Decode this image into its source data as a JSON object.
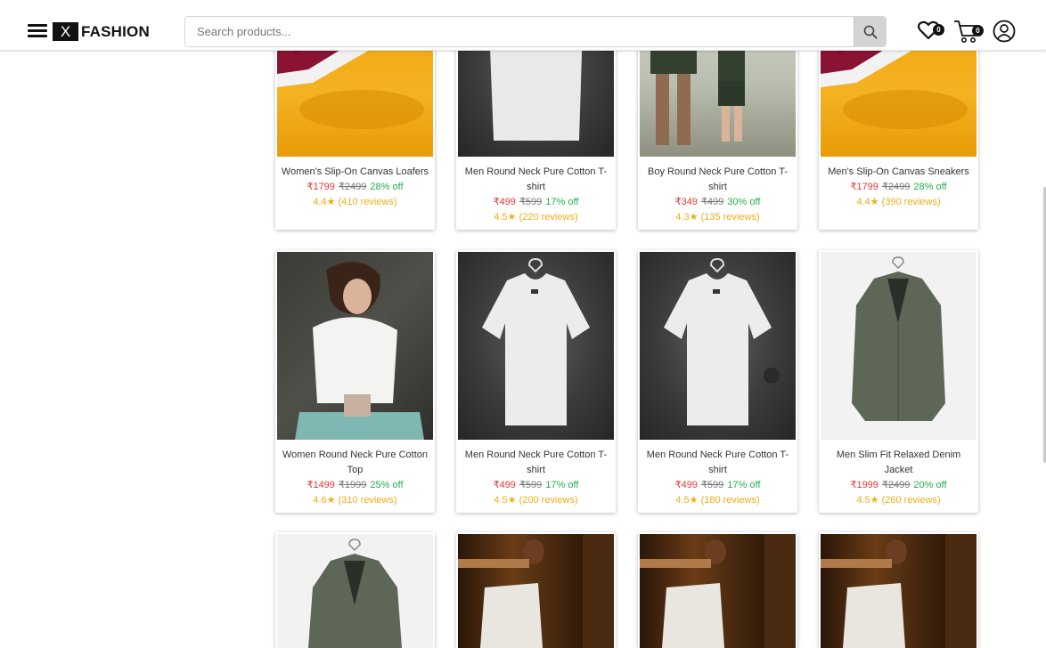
{
  "brand": {
    "logo_mark": "X",
    "name": "FASHION"
  },
  "header": {
    "search_placeholder": "Search products...",
    "wishlist_count": "0",
    "cart_count": "0",
    "icons": [
      "menu-icon",
      "search-icon",
      "heart-icon",
      "cart-icon",
      "user-icon"
    ]
  },
  "colors": {
    "price": "#e53935",
    "discount": "#22b14c",
    "rating": "#f0ad17",
    "brand_black": "#111111"
  },
  "products": [
    {
      "name": "Women's Slip-On Canvas Loafers",
      "price": "₹1799",
      "mrp": "₹2499",
      "off": "28% off",
      "rating": "4.4★ (410 reviews)"
    },
    {
      "name": "Men Round Neck Pure Cotton T-shirt",
      "price": "₹499",
      "mrp": "₹599",
      "off": "17% off",
      "rating": "4.5★ (220 reviews)"
    },
    {
      "name": "Boy Round Neck Pure Cotton T-shirt",
      "price": "₹349",
      "mrp": "₹499",
      "off": "30% off",
      "rating": "4.3★ (135 reviews)"
    },
    {
      "name": "Men's Slip-On Canvas Sneakers",
      "price": "₹1799",
      "mrp": "₹2499",
      "off": "28% off",
      "rating": "4.4★ (390 reviews)"
    },
    {
      "name": "Women Round Neck Pure Cotton Top",
      "price": "₹1499",
      "mrp": "₹1999",
      "off": "25% off",
      "rating": "4.6★ (310 reviews)"
    },
    {
      "name": "Men Round Neck Pure Cotton T-shirt",
      "price": "₹499",
      "mrp": "₹599",
      "off": "17% off",
      "rating": "4.5★ (200 reviews)"
    },
    {
      "name": "Men Round Neck Pure Cotton T-shirt",
      "price": "₹499",
      "mrp": "₹599",
      "off": "17% off",
      "rating": "4.5★ (180 reviews)"
    },
    {
      "name": "Men Slim Fit Relaxed Denim Jacket",
      "price": "₹1999",
      "mrp": "₹2499",
      "off": "20% off",
      "rating": "4.5★ (260 reviews)"
    },
    {
      "name": "",
      "price": "",
      "mrp": "",
      "off": "",
      "rating": ""
    },
    {
      "name": "",
      "price": "",
      "mrp": "",
      "off": "",
      "rating": ""
    },
    {
      "name": "",
      "price": "",
      "mrp": "",
      "off": "",
      "rating": ""
    },
    {
      "name": "",
      "price": "",
      "mrp": "",
      "off": "",
      "rating": ""
    }
  ]
}
